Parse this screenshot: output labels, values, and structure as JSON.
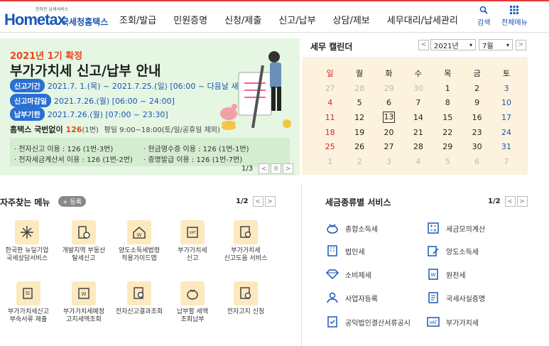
{
  "header": {
    "logo_small": "전자민 납세서비스",
    "logo_main": "Hometax",
    "logo_kr": "국세청홈택스",
    "nav": [
      "조회/발급",
      "민원증명",
      "신청/제출",
      "신고/납부",
      "상담/제보",
      "세무대리/납세관리"
    ],
    "search_label": "검색",
    "menu_label": "전체메뉴"
  },
  "banner": {
    "year": "2021년 1기 확정",
    "title": "부가가치세 신고/납부 안내",
    "rows": [
      {
        "tag": "신고기간",
        "text": "2021.7. 1.(목) ~ 2021.7.25.(일) [06:00 ~ 다음날 새벽 01:00]"
      },
      {
        "tag": "신고마감일",
        "text": "2021.7.26.(월) [06:00 ~ 24:00]"
      },
      {
        "tag": "납부기한",
        "text": "2021.7.26.(월) [07:00 ~ 23:30]"
      }
    ],
    "call_prefix": "홈택스 국번없이 ",
    "call_number": "126",
    "call_suffix": "(1번)",
    "call_hours": "평일 9:00~18:00(토/일/공휴일 제외)",
    "info": [
      "· 전자신고 이용 : 126 (1번-3번)",
      "· 현금영수증 이용 : 126 (1번-1번)",
      "· 전자세금계산서 이용 : 126 (1번-2번)",
      "· 증명발급 이용 : 126 (1번-7번)"
    ],
    "pager": "1/3",
    "prev": "<",
    "pause": "II",
    "next": ">"
  },
  "calendar": {
    "title": "세무 캘린더",
    "year": "2021년",
    "month": "7월",
    "prev": "<",
    "next": ">",
    "weekdays": [
      "일",
      "월",
      "화",
      "수",
      "목",
      "금",
      "토"
    ],
    "weeks": [
      [
        "27",
        "28",
        "29",
        "30",
        "1",
        "2",
        "3"
      ],
      [
        "4",
        "5",
        "6",
        "7",
        "8",
        "9",
        "10"
      ],
      [
        "11",
        "12",
        "13",
        "14",
        "15",
        "16",
        "17"
      ],
      [
        "18",
        "19",
        "20",
        "21",
        "22",
        "23",
        "24"
      ],
      [
        "25",
        "26",
        "27",
        "28",
        "29",
        "30",
        "31"
      ],
      [
        "1",
        "2",
        "3",
        "4",
        "5",
        "6",
        "7"
      ]
    ]
  },
  "frequent": {
    "title": "자주찾는 메뉴",
    "add_label": "+ 등록",
    "pager": "1/2",
    "prev": "<",
    "next": ">",
    "items": [
      "한국판 뉴딜기업\n국세상담서비스",
      "개발지역 부동산\n탈세신고",
      "양도소득세법령\n적용가이드맵",
      "부가가치세\n신고",
      "부가가치세\n신고도움 서비스",
      "부가가치세신고\n부속서류 제출",
      "부가가치세예정\n고지세액조회",
      "전자신고결과조회",
      "납부할 세액\n조회납부",
      "전자고지 신청"
    ]
  },
  "tax_services": {
    "title": "세금종류별 서비스",
    "pager": "1/2",
    "prev": "<",
    "next": ">",
    "items": [
      "종합소득세",
      "세금모의계산",
      "법인세",
      "양도소득세",
      "소비제세",
      "원천세",
      "사업자등록",
      "국세사실증명",
      "공익법인결산서류공시",
      "부가가치세"
    ]
  }
}
